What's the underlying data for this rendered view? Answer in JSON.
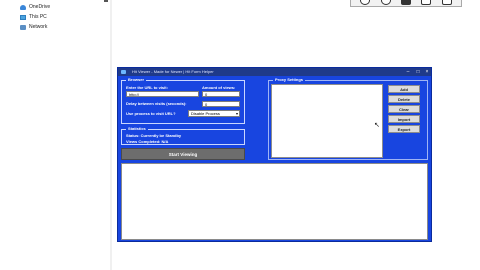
{
  "explorer": {
    "items": [
      {
        "label": "OneDrive",
        "icon": "onedrive-cloud-icon"
      },
      {
        "label": "This PC",
        "icon": "pc-icon"
      },
      {
        "label": "Network",
        "icon": "network-icon"
      }
    ]
  },
  "app": {
    "title": "Hit Viewer - Made for Newer | Hit Form Helper",
    "browser_group": {
      "legend": "Browser",
      "url_label": "Enter the URL to visit:",
      "url_value": "http://",
      "amount_label": "Amount of views:",
      "amount_value": "0",
      "delay_label": "Delay between visits (seconds):",
      "delay_value": "0",
      "process_label": "Use process to visit URL?",
      "process_selected": "Disable Process"
    },
    "statistics_group": {
      "legend": "Statistics",
      "status_line": "Status: Currently be Standby",
      "views_line": "Views Completed: N/A"
    },
    "start_button": "Start Viewing",
    "proxy_group": {
      "legend": "Proxy Settings"
    },
    "proxy_buttons": [
      "Add",
      "Delete",
      "Clear",
      "Import",
      "Export"
    ]
  },
  "colors": {
    "window_bg": "#1845e0",
    "title_bar": "#1f3a8a",
    "start_button": "#6d6d6d"
  }
}
